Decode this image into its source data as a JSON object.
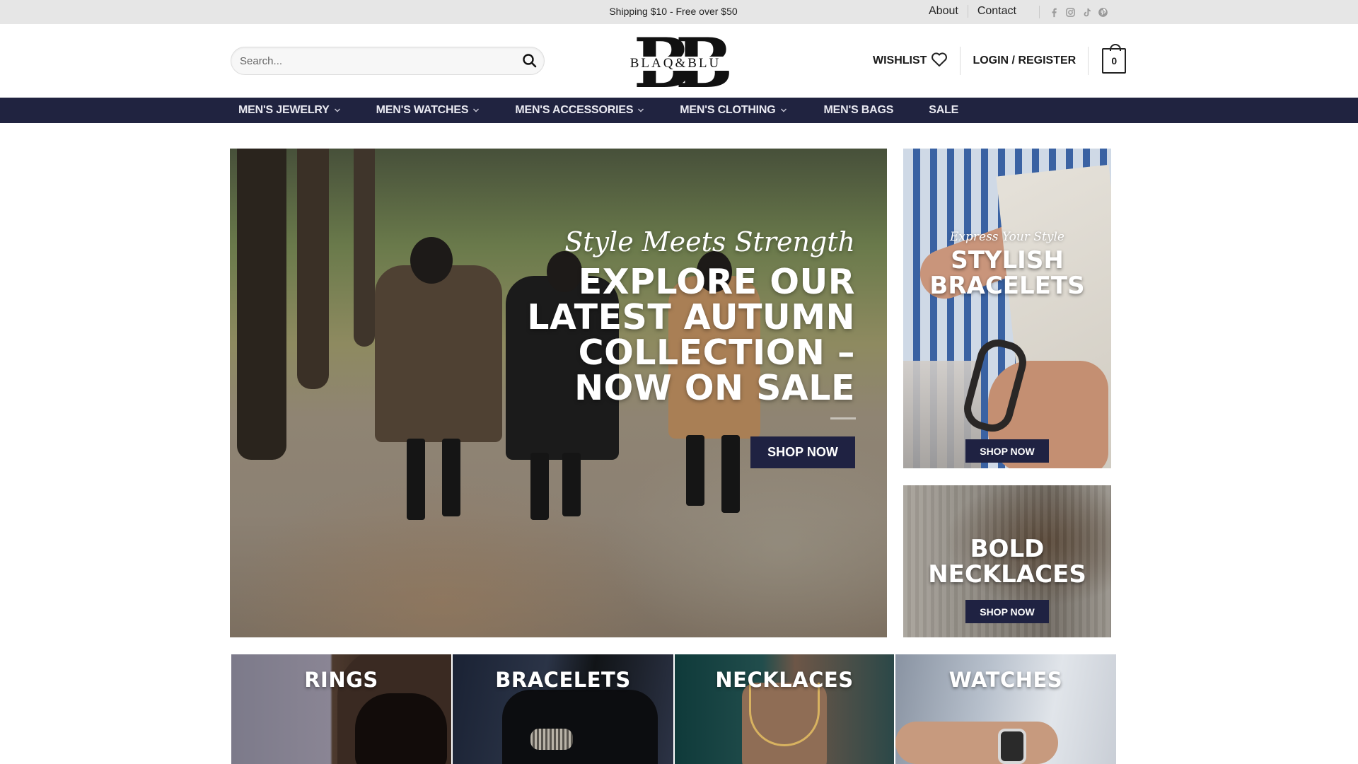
{
  "topbar": {
    "shipping": "Shipping $10 - Free over $50",
    "links": [
      "About",
      "Contact"
    ],
    "social_icons": [
      "facebook-icon",
      "instagram-icon",
      "tiktok-icon",
      "pinterest-icon"
    ]
  },
  "header": {
    "search_placeholder": "Search...",
    "logo_monogram": "BB",
    "logo_text": "BLAQ&BLU",
    "wishlist": "WISHLIST",
    "login": "LOGIN / REGISTER",
    "cart_count": "0"
  },
  "nav": {
    "items": [
      {
        "label": "MEN'S JEWELRY",
        "dropdown": true
      },
      {
        "label": "MEN'S WATCHES",
        "dropdown": true
      },
      {
        "label": "MEN'S ACCESSORIES",
        "dropdown": true
      },
      {
        "label": "MEN'S CLOTHING",
        "dropdown": true
      },
      {
        "label": "MEN'S BAGS",
        "dropdown": false
      },
      {
        "label": "SALE",
        "dropdown": false
      }
    ]
  },
  "hero": {
    "script": "Style Meets Strength",
    "headline": "EXPLORE OUR\nLATEST AUTUMN\nCOLLECTION –\nNOW ON SALE",
    "button": "SHOP NOW"
  },
  "promos": [
    {
      "kicker": "Express Your Style",
      "title": "STYLISH\nBRACELETS",
      "button": "SHOP NOW"
    },
    {
      "kicker": "",
      "title": "BOLD\nNECKLACES",
      "button": "SHOP NOW"
    }
  ],
  "categories": [
    "RINGS",
    "BRACELETS",
    "NECKLACES",
    "WATCHES"
  ],
  "colors": {
    "nav_bg": "#202340",
    "button_bg": "#1f2242",
    "topbar_bg": "#e6e6e6"
  }
}
